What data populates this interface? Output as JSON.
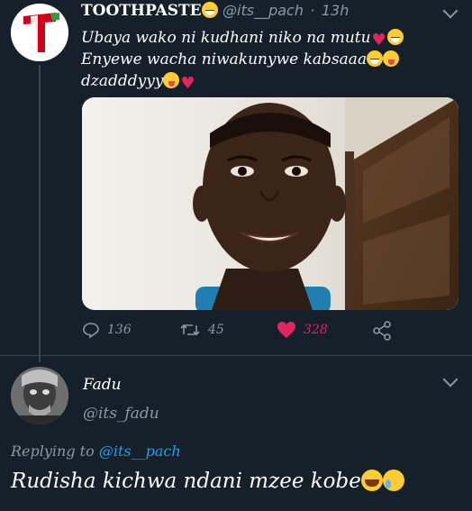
{
  "tweet": {
    "display_name": "TOOTHPASTE",
    "handle": "@its__pach",
    "separator": "·",
    "time": "13h",
    "lines": [
      "Ubaya wako ni kudhani niko na mutu",
      "Enyewe wacha niwakunywe kabsaaa",
      "dzadddyyy"
    ],
    "actions": {
      "replies": "136",
      "retweets": "45",
      "likes": "328"
    },
    "colors": {
      "background": "#15202b",
      "like": "#e0245e",
      "secondary_text": "#8899a6",
      "mention": "#1da1f2"
    },
    "icons": [
      "toothpaste-logo",
      "chevron-down-icon",
      "reply-icon",
      "retweet-icon",
      "heart-icon",
      "share-icon"
    ]
  },
  "reply": {
    "display_name": "Fadu",
    "handle": "@its_fadu",
    "replying_label": "Replying to",
    "replying_mention": "@its__pach",
    "text": "Rudisha kichwa ndani mzee kobe"
  }
}
